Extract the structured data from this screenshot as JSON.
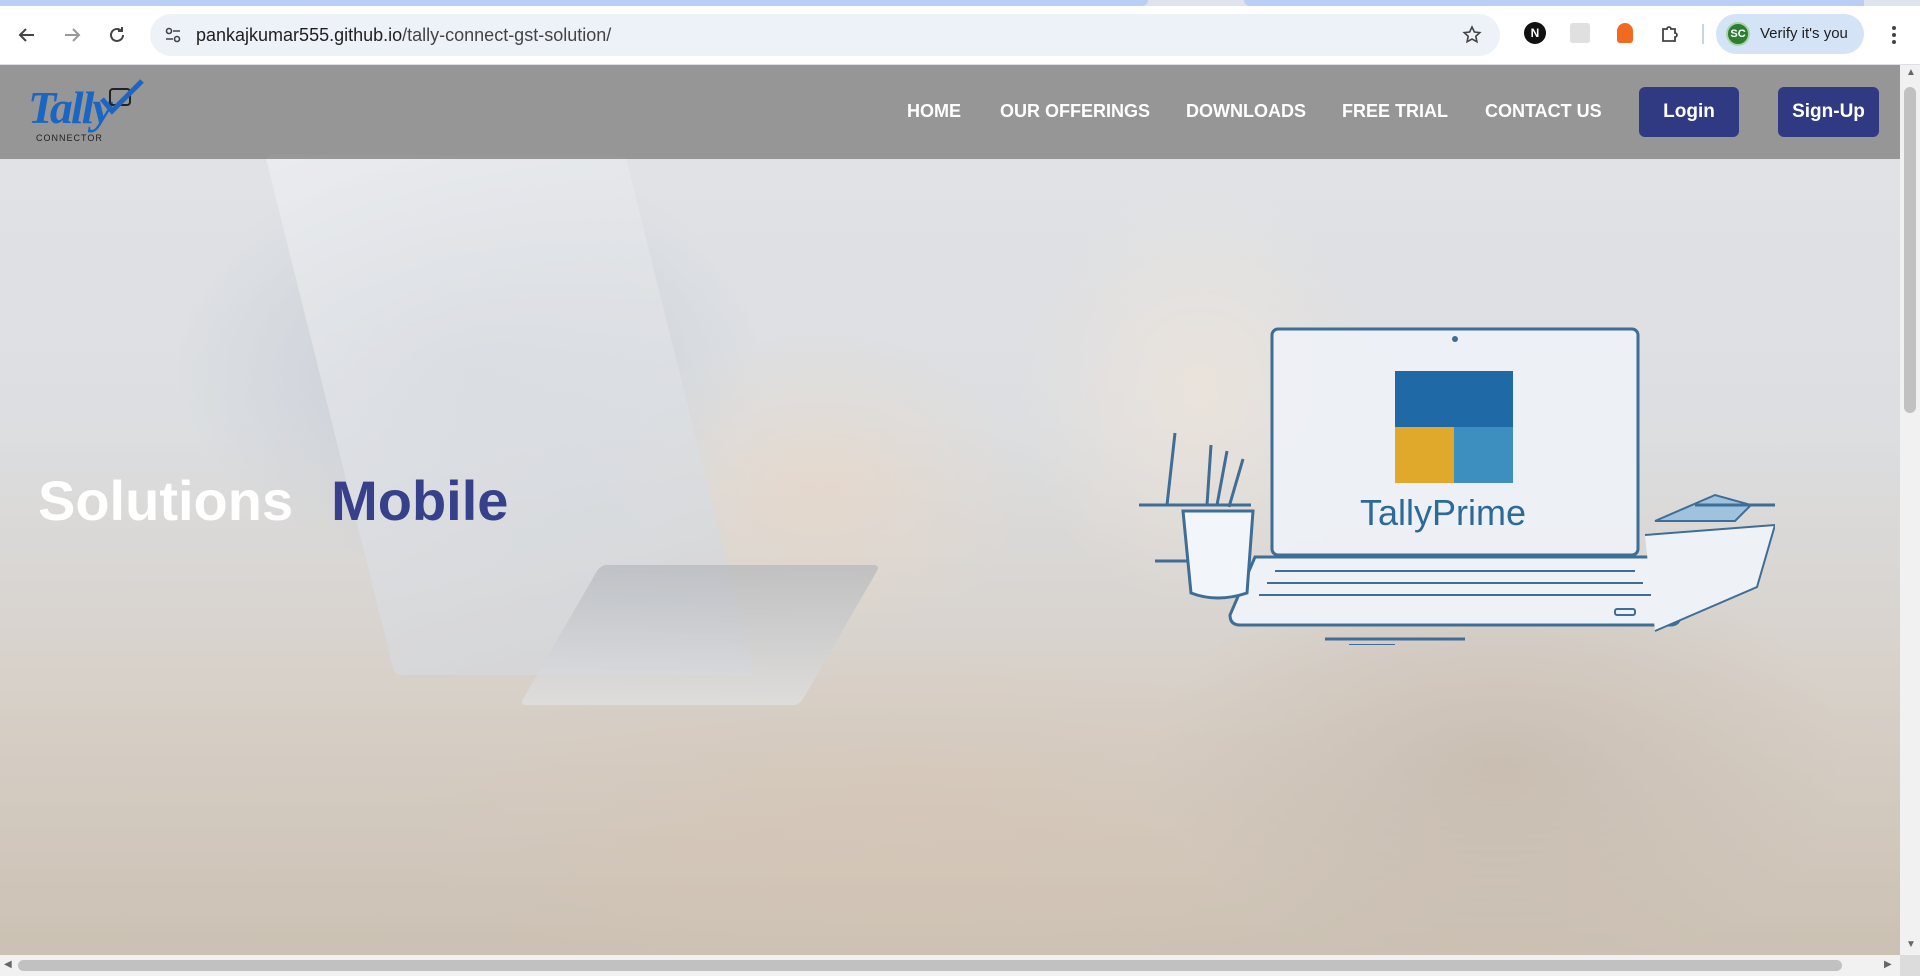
{
  "browser": {
    "url_host": "pankajkumar555.github.io",
    "url_path": "/tally-connect-gst-solution/",
    "verify_label": "Verify it's you",
    "profile_initials": "SC",
    "extensions": [
      "notion-icon",
      "extension-gray-icon",
      "extension-orange-icon",
      "puzzle-icon"
    ]
  },
  "site": {
    "logo_text": "Tally",
    "logo_sub": "CONNECTOR",
    "nav": [
      "HOME",
      "OUR OFFERINGS",
      "DOWNLOADS",
      "FREE TRIAL",
      "CONTACT US"
    ],
    "login_label": "Login",
    "signup_label": "Sign-Up"
  },
  "hero": {
    "word1": "Solutions",
    "word2": "Mobile",
    "product_name": "TallyPrime"
  },
  "colors": {
    "brand_button": "#2f3a82",
    "hero_accent": "#37408a",
    "logo_blue": "#1a66c2"
  }
}
